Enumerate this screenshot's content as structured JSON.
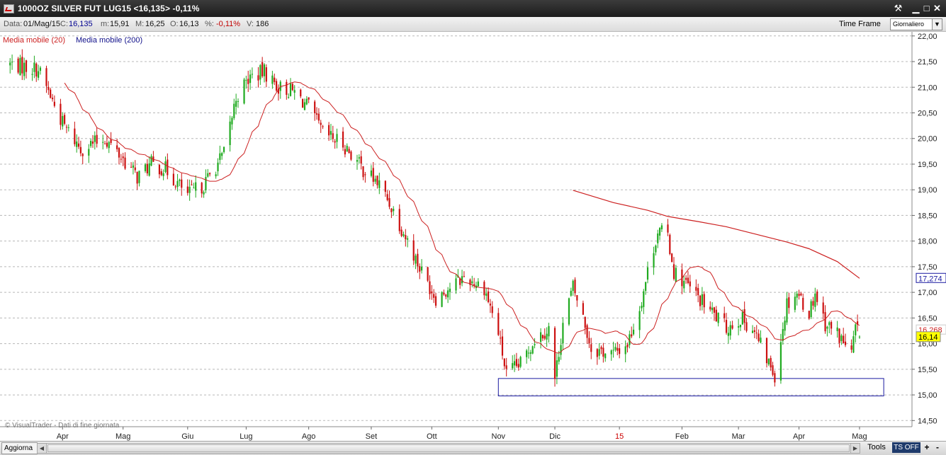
{
  "window": {
    "title": "1000OZ SILVER FUT LUG15 <16,135> -0,11%"
  },
  "infobar": {
    "date_label": "Data:",
    "date_value": "01/Mag/15",
    "close_label": "C:",
    "close_value": "16,135",
    "min_label": "m:",
    "min_value": "15,91",
    "max_label": "M:",
    "max_value": "16,25",
    "open_label": "O:",
    "open_value": "16,13",
    "pct_label": "%:",
    "pct_value": "-0,11%",
    "vol_label": "V:",
    "vol_value": "186",
    "timeframe_label": "Time Frame",
    "timeframe_value": "Giornaliero"
  },
  "bottombar": {
    "refresh_label": "Aggiorna",
    "tools_label": "Tools",
    "ts_label": "TS OFF",
    "plus_label": "+",
    "minus_label": "-"
  },
  "colors": {
    "up": "#1faa1f",
    "down": "#cc1010",
    "ma20": "#cc2020",
    "ma200": "#10108a",
    "grid": "#b8b8b8",
    "box": "#1a1aa0",
    "last_price_bg": "#ffff00",
    "month_highlight": "#cc0000"
  },
  "chart_data": {
    "type": "candlestick",
    "instrument": "1000OZ SILVER FUT LUG15",
    "legend": [
      {
        "name": "Media mobile (20)",
        "color": "#cc2020"
      },
      {
        "name": "Media mobile (200)",
        "color": "#10108a"
      }
    ],
    "watermark": "© VisualTrader - Dati di fine giornata",
    "y_axis": {
      "ticks": [
        "14,50",
        "15,00",
        "15,50",
        "16,00",
        "16,50",
        "17,00",
        "17,50",
        "18,00",
        "18,50",
        "19,00",
        "19,50",
        "20,00",
        "20,50",
        "21,00",
        "21,50",
        "22,00"
      ],
      "range": [
        14.38,
        22.08
      ]
    },
    "x_axis": {
      "months": [
        {
          "label": "Apr",
          "start": "2014-04-01",
          "highlight": false
        },
        {
          "label": "Mag",
          "start": "2014-05-01",
          "highlight": false
        },
        {
          "label": "Giu",
          "start": "2014-06-02",
          "highlight": false
        },
        {
          "label": "Lug",
          "start": "2014-07-01",
          "highlight": false
        },
        {
          "label": "Ago",
          "start": "2014-08-01",
          "highlight": false
        },
        {
          "label": "Set",
          "start": "2014-09-01",
          "highlight": false
        },
        {
          "label": "Ott",
          "start": "2014-10-01",
          "highlight": false
        },
        {
          "label": "Nov",
          "start": "2014-11-03",
          "highlight": false
        },
        {
          "label": "Dic",
          "start": "2014-12-01",
          "highlight": false
        },
        {
          "label": "15",
          "start": "2015-01-02",
          "highlight": true
        },
        {
          "label": "Feb",
          "start": "2015-02-02",
          "highlight": false
        },
        {
          "label": "Mar",
          "start": "2015-03-02",
          "highlight": false
        },
        {
          "label": "Apr",
          "start": "2015-04-01",
          "highlight": false
        },
        {
          "label": "Mag",
          "start": "2015-05-01",
          "highlight": false
        }
      ]
    },
    "price_path": [
      [
        "2014-03-06",
        21.45
      ],
      [
        "2014-03-20",
        21.35
      ],
      [
        "2014-04-01",
        20.3
      ],
      [
        "2014-04-10",
        19.8
      ],
      [
        "2014-04-22",
        20.0
      ],
      [
        "2014-05-01",
        19.6
      ],
      [
        "2014-05-08",
        19.25
      ],
      [
        "2014-05-15",
        19.5
      ],
      [
        "2014-05-22",
        19.4
      ],
      [
        "2014-06-02",
        18.9
      ],
      [
        "2014-06-10",
        19.1
      ],
      [
        "2014-06-20",
        19.7
      ],
      [
        "2014-06-26",
        20.8
      ],
      [
        "2014-07-03",
        21.2
      ],
      [
        "2014-07-10",
        21.3
      ],
      [
        "2014-07-17",
        21.0
      ],
      [
        "2014-07-25",
        20.9
      ],
      [
        "2014-08-01",
        20.6
      ],
      [
        "2014-08-08",
        20.1
      ],
      [
        "2014-08-18",
        19.9
      ],
      [
        "2014-08-28",
        19.4
      ],
      [
        "2014-09-05",
        19.1
      ],
      [
        "2014-09-12",
        18.6
      ],
      [
        "2014-09-19",
        18.0
      ],
      [
        "2014-09-26",
        17.4
      ],
      [
        "2014-10-03",
        16.9
      ],
      [
        "2014-10-10",
        17.1
      ],
      [
        "2014-10-17",
        17.3
      ],
      [
        "2014-10-27",
        17.1
      ],
      [
        "2014-11-03",
        16.2
      ],
      [
        "2014-11-07",
        15.4
      ],
      [
        "2014-11-14",
        15.6
      ],
      [
        "2014-11-21",
        16.1
      ],
      [
        "2014-11-28",
        16.3
      ],
      [
        "2014-12-01",
        15.3
      ],
      [
        "2014-12-05",
        16.4
      ],
      [
        "2014-12-10",
        17.1
      ],
      [
        "2014-12-15",
        16.5
      ],
      [
        "2014-12-19",
        15.9
      ],
      [
        "2014-12-30",
        15.8
      ],
      [
        "2015-01-06",
        16.0
      ],
      [
        "2015-01-12",
        16.7
      ],
      [
        "2015-01-16",
        17.4
      ],
      [
        "2015-01-21",
        18.2
      ],
      [
        "2015-01-26",
        18.1
      ],
      [
        "2015-01-29",
        17.4
      ],
      [
        "2015-02-03",
        17.2
      ],
      [
        "2015-02-10",
        16.9
      ],
      [
        "2015-02-17",
        16.6
      ],
      [
        "2015-02-24",
        16.3
      ],
      [
        "2015-03-03",
        16.5
      ],
      [
        "2015-03-09",
        16.3
      ],
      [
        "2015-03-16",
        15.7
      ],
      [
        "2015-03-20",
        15.4
      ],
      [
        "2015-03-26",
        16.8
      ],
      [
        "2015-03-31",
        17.0
      ],
      [
        "2015-04-06",
        16.6
      ],
      [
        "2015-04-09",
        17.0
      ],
      [
        "2015-04-14",
        16.4
      ],
      [
        "2015-04-20",
        16.2
      ],
      [
        "2015-04-27",
        15.8
      ],
      [
        "2015-04-29",
        16.3
      ],
      [
        "2015-05-01",
        16.135
      ]
    ],
    "ma200_path": [
      [
        "2014-12-10",
        18.99
      ],
      [
        "2014-12-30",
        18.75
      ],
      [
        "2015-01-16",
        18.6
      ],
      [
        "2015-01-26",
        18.48
      ],
      [
        "2015-02-10",
        18.38
      ],
      [
        "2015-02-24",
        18.28
      ],
      [
        "2015-03-09",
        18.15
      ],
      [
        "2015-03-26",
        17.98
      ],
      [
        "2015-04-06",
        17.85
      ],
      [
        "2015-04-20",
        17.6
      ],
      [
        "2015-05-01",
        17.274
      ]
    ],
    "support_box": {
      "x_start": "2014-11-03",
      "x_end": "2015-05-13",
      "y_low": 14.98,
      "y_high": 15.32
    },
    "price_labels": [
      {
        "value": 17.274,
        "text": "17,274",
        "style": "ma200"
      },
      {
        "value": 16.268,
        "text": "16,268",
        "style": "ma20"
      },
      {
        "value": 16.135,
        "text": "16,14",
        "style": "last"
      }
    ]
  }
}
